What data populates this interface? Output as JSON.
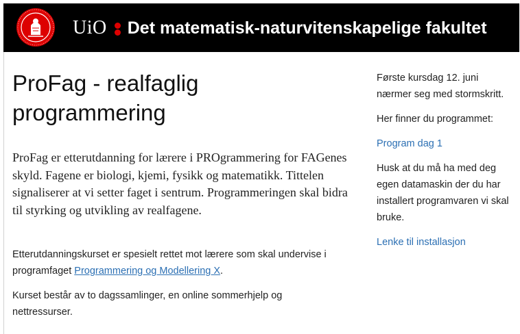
{
  "header": {
    "brand_short": "UiO",
    "faculty": "Det matematisk-naturvitenskapelige fakultet",
    "logo": "uio-seal-logo",
    "colors": {
      "bar": "#000000",
      "accent": "#dd0000",
      "seal": "#dd0000"
    }
  },
  "main": {
    "title": "ProFag - realfaglig programmering",
    "intro": "ProFag er etterutdanning for lærere i PROgrammering for FAGenes skyld. Fagene er biologi, kjemi, fysikk og matematikk. Tittelen signaliserer at vi setter faget i sentrum. Programmeringen skal bidra til styrking og utvikling av realfagene.",
    "para1_text": "Etterutdanningskurset er spesielt rettet mot lærere som skal undervise i programfaget ",
    "para1_link": "Programmering og Modellering X",
    "para1_end": ".",
    "para2": "Kurset består av to dagssamlinger, en online sommerhjelp og nettressurser."
  },
  "aside": {
    "p1": "Første kursdag 12. juni nærmer seg med stormskritt.",
    "p2": "Her finner du programmet:",
    "link1": "Program dag 1",
    "p3": "Husk at du må ha med deg egen datamaskin der du har installert programvaren vi skal bruke.",
    "link2": "Lenke til installasjon",
    "link_color": "#2b6fb3"
  }
}
